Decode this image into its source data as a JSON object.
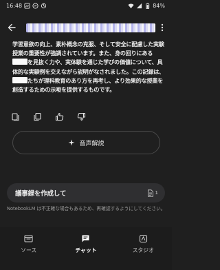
{
  "status_bar": {
    "time": "16:48",
    "battery": "84%"
  },
  "header": {
    "title_redacted": true
  },
  "answer": {
    "p1": "学習意欲の向上、素朴概念の克服、そして安全に配慮した実験授業の重要性が強調されています。また、",
    "p2": "身の回りにある",
    "p3": "を見抜く力や、実体験を通じた学びの価値について、具体的な実験例を交えながら説明がなされました。この記録は、",
    "p4": "たちが理科教育のあり方を再考し、より効果的な授業を創造するための示唆を提供するものです。"
  },
  "actions": {
    "save_icon": "save-to-note-icon",
    "copy_icon": "copy-icon",
    "like_icon": "thumbs-up-icon",
    "dislike_icon": "thumbs-down-icon"
  },
  "audio_button": {
    "label": "音声解説"
  },
  "input": {
    "label": "議事録を作成して",
    "source_count": "1"
  },
  "disclaimer": "NotebookLM は不正確な場合もあるため、再確認するようにしてください。",
  "nav": {
    "items": [
      {
        "label": "ソース",
        "active": false
      },
      {
        "label": "チャット",
        "active": true
      },
      {
        "label": "スタジオ",
        "active": false
      }
    ]
  }
}
